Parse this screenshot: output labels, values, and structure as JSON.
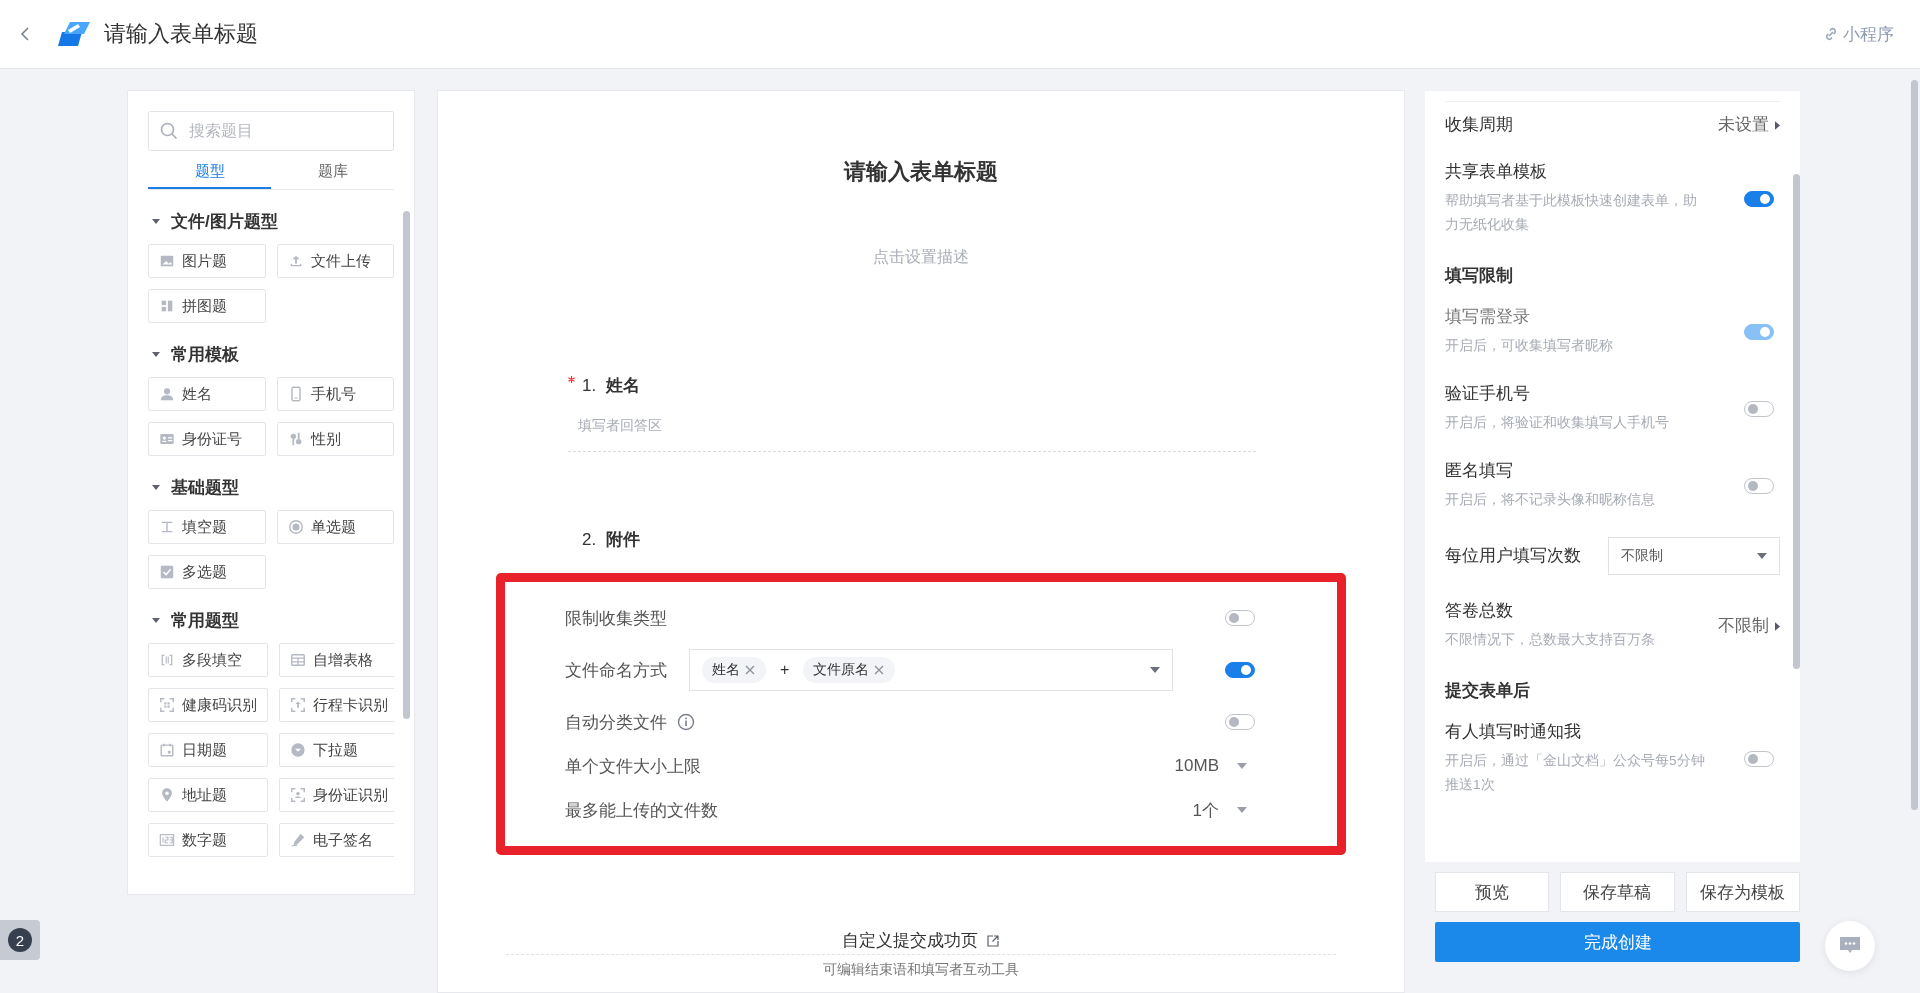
{
  "header": {
    "title": "请输入表单标题",
    "mini_program": "小程序"
  },
  "sidebar": {
    "search": {
      "placeholder": "搜索题目"
    },
    "tabs": [
      {
        "label": "题型",
        "selected": true
      },
      {
        "label": "题库",
        "selected": false
      }
    ],
    "groups": [
      {
        "title": "文件/图片题型",
        "expanded": true,
        "items": [
          "图片题",
          "文件上传",
          "拼图题"
        ]
      },
      {
        "title": "常用模板",
        "expanded": true,
        "items": [
          "姓名",
          "手机号",
          "身份证号",
          "性别"
        ]
      },
      {
        "title": "基础题型",
        "expanded": true,
        "items": [
          "填空题",
          "单选题",
          "多选题"
        ]
      },
      {
        "title": "常用题型",
        "expanded": true,
        "items": [
          "多段填空",
          "自增表格",
          "健康码识别",
          "行程卡识别",
          "日期题",
          "下拉题",
          "地址题",
          "身份证识别",
          "数字题",
          "电子签名"
        ]
      }
    ]
  },
  "form": {
    "title": "请输入表单标题",
    "description": "点击设置描述",
    "questions": [
      {
        "number": "1.",
        "title": "姓名",
        "required": true,
        "placeholder": "填写者回答区"
      },
      {
        "number": "2.",
        "title": "附件",
        "required": false
      }
    ],
    "attachment_settings": [
      {
        "kind": "toggle",
        "label": "限制收集类型",
        "on": false,
        "info": false
      },
      {
        "kind": "naming",
        "label": "文件命名方式",
        "tags": [
          "姓名",
          "文件原名"
        ],
        "joiner": "+",
        "on": true
      },
      {
        "kind": "toggle",
        "label": "自动分类文件",
        "on": false,
        "info": true
      },
      {
        "kind": "select",
        "label": "单个文件大小上限",
        "value": "10MB"
      },
      {
        "kind": "select",
        "label": "最多能上传的文件数",
        "value": "1个"
      }
    ],
    "success_page": {
      "label": "自定义提交成功页",
      "note": "可编辑结束语和填写者互动工具"
    }
  },
  "settings": [
    {
      "kind": "link",
      "label": "收集周期",
      "value": "未设置"
    },
    {
      "kind": "toggle",
      "label": "共享表单模板",
      "description": "帮助填写者基于此模板快速创建表单，助力无纸化收集",
      "on": true,
      "disabled": false
    },
    {
      "kind": "heading",
      "label": "填写限制"
    },
    {
      "kind": "toggle",
      "label": "填写需登录",
      "description": "开启后，可收集填写者昵称",
      "on": true,
      "disabled": true
    },
    {
      "kind": "toggle",
      "label": "验证手机号",
      "description": "开启后，将验证和收集填写人手机号",
      "on": false,
      "disabled": false
    },
    {
      "kind": "toggle",
      "label": "匿名填写",
      "description": "开启后，将不记录头像和昵称信息",
      "on": false,
      "disabled": false
    },
    {
      "kind": "select",
      "label": "每位用户填写次数",
      "value": "不限制"
    },
    {
      "kind": "link",
      "label": "答卷总数",
      "description": "不限情况下，总数最大支持百万条",
      "value": "不限制"
    },
    {
      "kind": "heading",
      "label": "提交表单后"
    },
    {
      "kind": "toggle",
      "label": "有人填写时通知我",
      "description": "开启后，通过「金山文档」公众号每5分钟推送1次",
      "on": false,
      "disabled": false
    }
  ],
  "actions": {
    "buttons": [
      "预览",
      "保存草稿",
      "保存为模板"
    ],
    "primary": "完成创建"
  },
  "badge": "2"
}
